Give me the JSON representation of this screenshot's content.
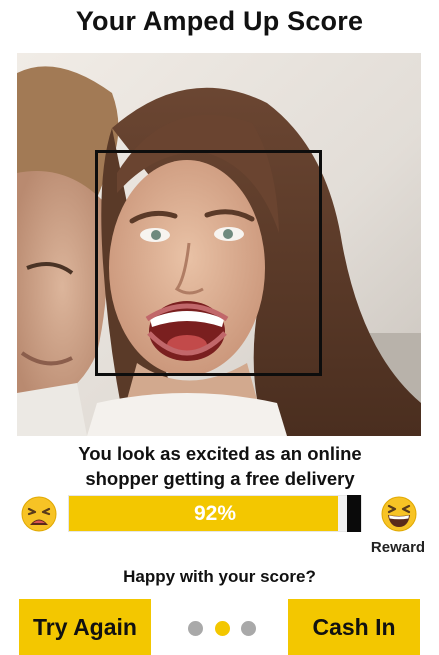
{
  "header": {
    "title": "Your Amped Up Score"
  },
  "result": {
    "caption_line1": "You look as excited as an online",
    "caption_line2": "shopper getting a free delivery",
    "score_label": "92%",
    "score_value": 92,
    "reward_label": "Reward"
  },
  "icons": {
    "left_emoji": "weary-face-icon",
    "right_emoji": "grinning-squinting-face-icon"
  },
  "prompt": {
    "question": "Happy with your score?"
  },
  "actions": {
    "try_again_label": "Try Again",
    "cash_in_label": "Cash In"
  },
  "pager": {
    "total": 3,
    "active_index": 1
  },
  "colors": {
    "accent": "#f3c700",
    "bar_track": "#f2f2f2",
    "marker": "#0a0a0a",
    "dot_inactive": "#a9a9a9"
  }
}
